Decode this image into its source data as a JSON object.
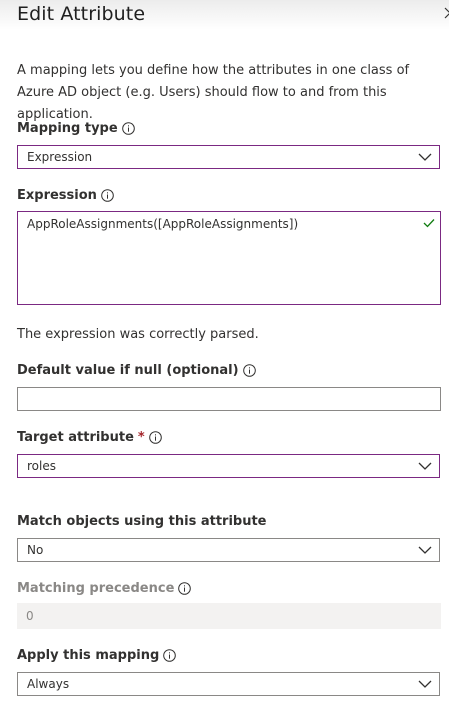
{
  "panel": {
    "title": "Edit Attribute",
    "description": "A mapping lets you define how the attributes in one class of Azure AD object (e.g. Users) should flow to and from this application."
  },
  "mapping_type": {
    "label": "Mapping type",
    "value": "Expression"
  },
  "expression": {
    "label": "Expression",
    "value": "AppRoleAssignments([AppRoleAssignments])",
    "status": "The expression was correctly parsed."
  },
  "default_value": {
    "label": "Default value if null (optional)",
    "value": ""
  },
  "target_attribute": {
    "label": "Target attribute",
    "required_marker": "*",
    "value": "roles"
  },
  "match_objects": {
    "label": "Match objects using this attribute",
    "value": "No"
  },
  "matching_precedence": {
    "label": "Matching precedence",
    "value": "0"
  },
  "apply_mapping": {
    "label": "Apply this mapping",
    "value": "Always"
  },
  "colors": {
    "focus_border": "#7b2982",
    "success_check": "#107c10",
    "required": "#a4262c"
  },
  "icons": [
    "close-icon",
    "info-icon",
    "chevron-down-icon",
    "checkmark-icon"
  ]
}
